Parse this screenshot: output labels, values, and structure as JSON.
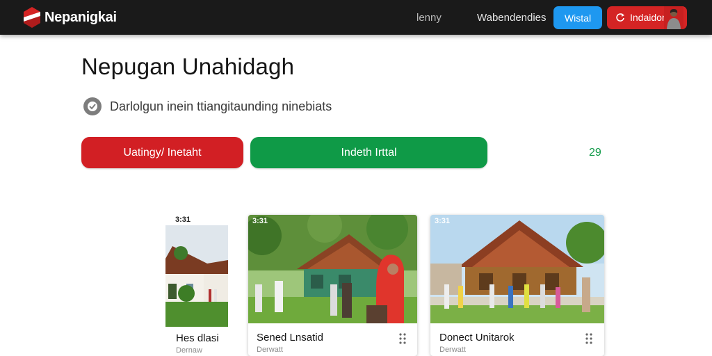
{
  "header": {
    "brand": "Nepanigkai",
    "nav": [
      "lenny",
      "Wabendendies"
    ],
    "blue_button": "Wistal",
    "red_button": "Indaidon"
  },
  "main": {
    "title": "Nepugan Unahidagh",
    "subtitle": "Darlolgun inein ttiangitaunding ninebiats",
    "primary_button": "Uatingy/ Inetaht",
    "secondary_button": "Indeth Irttal",
    "count": "29"
  },
  "cards": [
    {
      "time": "3:31",
      "title": "Hes dlasi",
      "meta": "Dernaw"
    },
    {
      "time": "3:31",
      "title": "Sened Lnsatid",
      "meta": "Derwatt"
    },
    {
      "time": "3:31",
      "title": "Donect Unitarok",
      "meta": "Derwatt"
    }
  ],
  "colors": {
    "topbar": "#1a1a1a",
    "blue": "#1e98f0",
    "red": "#d21f24",
    "green": "#0f9a47"
  },
  "icons": [
    "logo-icon",
    "refresh-icon",
    "person-avatar",
    "check-badge-icon",
    "more-vertical-icon"
  ]
}
